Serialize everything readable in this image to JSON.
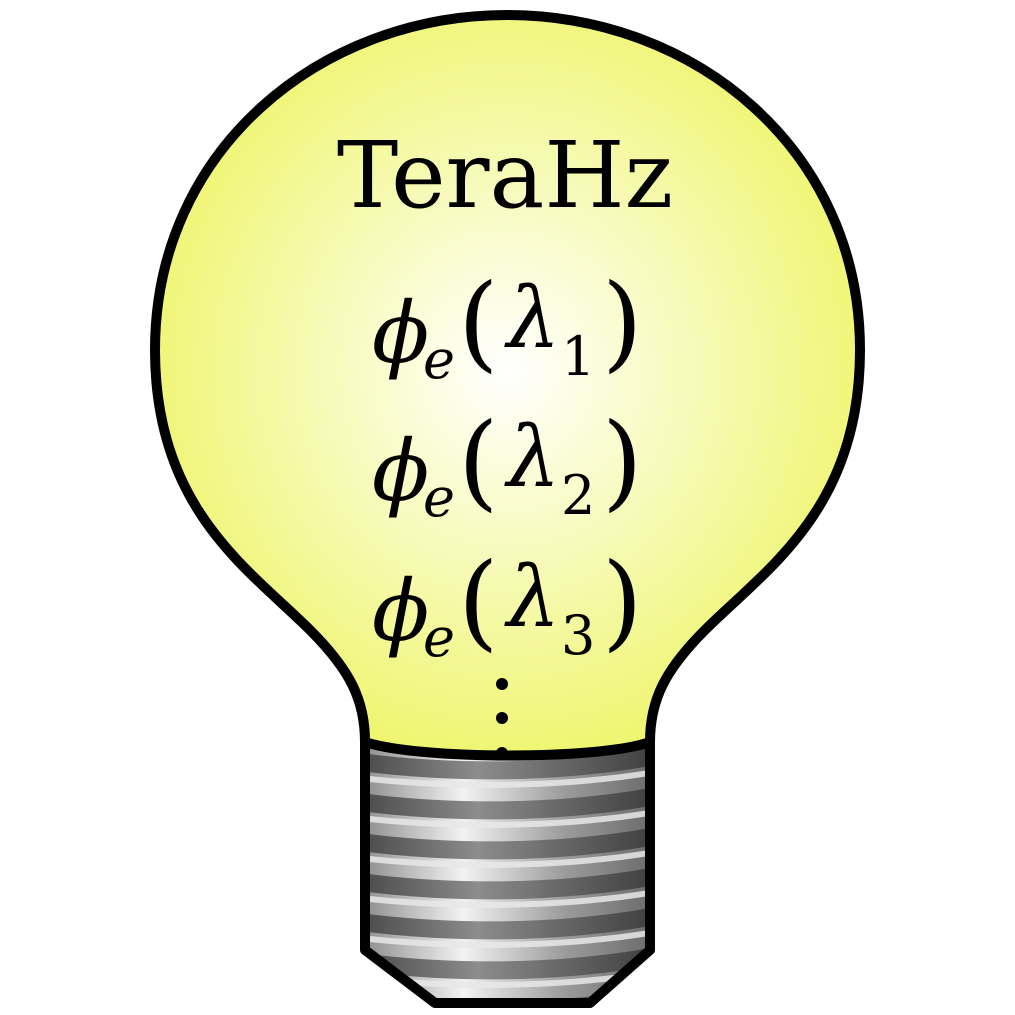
{
  "title": "TeraHz",
  "rows": [
    {
      "symbol": "ϕ",
      "subscript": "e",
      "open": "(",
      "variable": "λ",
      "index": "1",
      "close": ")"
    },
    {
      "symbol": "ϕ",
      "subscript": "e",
      "open": "(",
      "variable": "λ",
      "index": "2",
      "close": ")"
    },
    {
      "symbol": "ϕ",
      "subscript": "e",
      "open": "(",
      "variable": "λ",
      "index": "3",
      "close": ")"
    }
  ],
  "colors": {
    "glass_center": "#ffffff",
    "glass_edge": "#eef56a",
    "outline": "#000000",
    "thread_light": "#e8e8e8",
    "thread_dark": "#5a5a5a"
  },
  "icons": {
    "continuation": "vertical-ellipsis-icon",
    "bulb": "light-bulb-icon"
  }
}
